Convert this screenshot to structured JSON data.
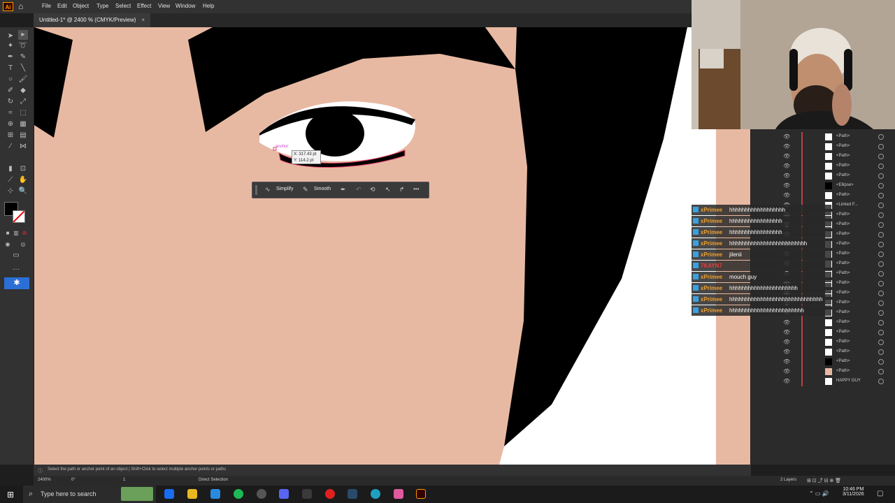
{
  "app": {
    "logo_text": "Ai",
    "brand_color": "#ff9a00"
  },
  "menu": [
    "File",
    "Edit",
    "Object",
    "Type",
    "Select",
    "Effect",
    "View",
    "Window",
    "Help"
  ],
  "document_tab": {
    "title": "Untitled-1* @ 2400 % (CMYK/Preview)",
    "close": "×"
  },
  "canvas_hint": {
    "anchor_label": "anchor",
    "x_readout": "X: 317.43 pt",
    "y_readout": "Y: 114.2 pt"
  },
  "context_toolbar": {
    "simplify_label": "Simplify",
    "smooth_label": "Smooth",
    "more": "•••"
  },
  "layers": [
    {
      "name": "<Path>",
      "thumb": "#ffffff"
    },
    {
      "name": "<Path>",
      "thumb": "#ffffff"
    },
    {
      "name": "<Path>",
      "thumb": "#ffffff"
    },
    {
      "name": "<Path>",
      "thumb": "#ffffff"
    },
    {
      "name": "<Path>",
      "thumb": "#ffffff"
    },
    {
      "name": "<Ellipse>",
      "thumb": "#000000"
    },
    {
      "name": "<Path>",
      "thumb": "#ffffff"
    },
    {
      "name": "<Linked F...",
      "thumb": "#ffffff"
    },
    {
      "name": "<Path>",
      "thumb": "#ffffff"
    },
    {
      "name": "<Path>",
      "thumb": "#ffffff"
    },
    {
      "name": "<Path>",
      "thumb": "#ffffff"
    },
    {
      "name": "<Path>",
      "thumb": "#ffffff"
    },
    {
      "name": "<Path>",
      "thumb": "#ffffff"
    },
    {
      "name": "<Path>",
      "thumb": "#ffffff"
    },
    {
      "name": "<Path>",
      "thumb": "#ffffff"
    },
    {
      "name": "<Path>",
      "thumb": "#ffffff"
    },
    {
      "name": "<Path>",
      "thumb": "#ffffff"
    },
    {
      "name": "<Path>",
      "thumb": "#ffffff"
    },
    {
      "name": "<Path>",
      "thumb": "#ffffff"
    },
    {
      "name": "<Path>",
      "thumb": "#ffffff"
    },
    {
      "name": "<Path>",
      "thumb": "#ffffff"
    },
    {
      "name": "<Path>",
      "thumb": "#ffffff"
    },
    {
      "name": "<Path>",
      "thumb": "#ffffff"
    },
    {
      "name": "<Path>",
      "thumb": "#000000"
    },
    {
      "name": "<Path>",
      "thumb": "#e8b9a2"
    },
    {
      "name": "HAPPY GUY",
      "thumb": "#ffffff"
    }
  ],
  "chat": [
    {
      "user": "xPrimee",
      "msg": "hhhhhhhhhhhhhhhhhh",
      "user_color": "#f0a030"
    },
    {
      "user": "xPrimee",
      "msg": "hhhhhhhhhhhhhhhhh",
      "user_color": "#f0a030"
    },
    {
      "user": "xPrimee",
      "msg": "hhhhhhhhhhhhhhhhh",
      "user_color": "#f0a030"
    },
    {
      "user": "xPrimee",
      "msg": "hhhhhhhhhhhhhhhhhhhhhhhhh",
      "user_color": "#f0a030"
    },
    {
      "user": "xPrimee",
      "msg": "jilenii",
      "user_color": "#f0a030"
    },
    {
      "user": "7KAYN7",
      "msg": "",
      "user_color": "#e04040"
    },
    {
      "user": "xPrimee",
      "msg": "mouch guy",
      "user_color": "#f0a030"
    },
    {
      "user": "xPrimee",
      "msg": "hhhhhhhhhhhhhhhhhhhhhh",
      "user_color": "#f0a030"
    },
    {
      "user": "xPrimee",
      "msg": "hhhhhhhhhhhhhhhhhhhhhhhhhhhhhh",
      "user_color": "#f0a030"
    },
    {
      "user": "xPrimee",
      "msg": "hhhhhhhhhhhhhhhhhhhhhhhh",
      "user_color": "#f0a030"
    }
  ],
  "statusbar": {
    "hint": "Select the path or anchor point of an object  |  Shift+Click to select multiple anchor points or paths"
  },
  "bottombar": {
    "zoom": "2400%",
    "rotation": "0°",
    "artboard": "1",
    "tool": "Direct Selection",
    "layers_count": "2 Layers"
  },
  "taskbar": {
    "search_placeholder": "Type here to search",
    "time": "10:46 PM",
    "date": "3/11/2026"
  },
  "colors": {
    "skin": "#e8b9a2",
    "hair": "#000000",
    "ui_dark": "#323232"
  }
}
